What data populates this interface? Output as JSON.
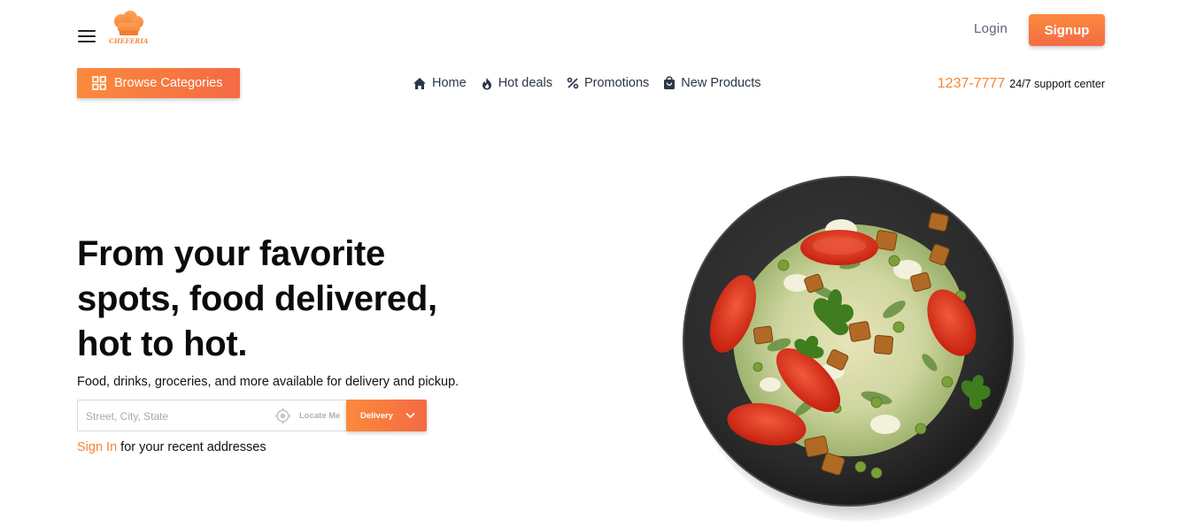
{
  "brand": {
    "logo_text": "CHEFERIA",
    "accent_color": "#f58634",
    "accent_color_end": "#f46a44"
  },
  "header": {
    "menu_icon": "hamburger-menu-icon",
    "login_label": "Login",
    "signup_label": "Signup"
  },
  "toolbar": {
    "browse_label": "Browse Categories",
    "browse_icon": "grid-icon"
  },
  "nav": {
    "items": [
      {
        "label": "Home",
        "icon": "home-icon"
      },
      {
        "label": "Hot deals",
        "icon": "flame-icon"
      },
      {
        "label": "Promotions",
        "icon": "percent-icon"
      },
      {
        "label": "New Products",
        "icon": "shopping-bag-icon"
      }
    ]
  },
  "support": {
    "phone": "1237-7777",
    "text": "24/7 support center"
  },
  "hero": {
    "title_lines": [
      "From your favorite",
      "spots, food delivered,",
      "hot to hot."
    ],
    "subtitle": "Food, drinks, groceries, and more available for delivery and pickup.",
    "address_placeholder": "Street, City, State",
    "address_value": "",
    "locate_label": "Locate Me",
    "delivery_label": "Delivery",
    "signin_link": "Sign In",
    "signin_rest": " for your recent addresses"
  },
  "image": {
    "icon": "salad-plate-image"
  }
}
